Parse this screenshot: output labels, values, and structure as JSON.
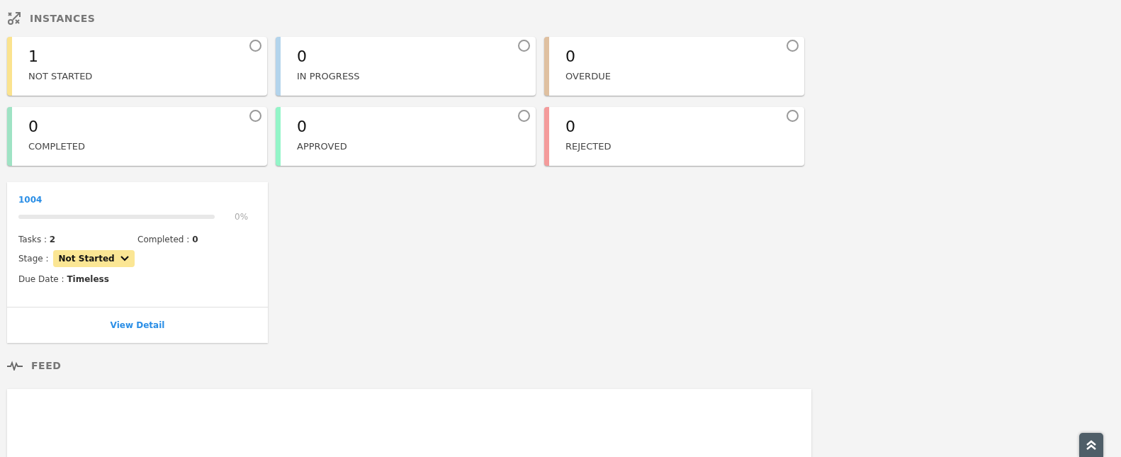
{
  "instances_header": {
    "title": "INSTANCES"
  },
  "stat_cards": [
    {
      "count": "1",
      "label": "NOT STARTED",
      "color": "#fbe38e",
      "selected": false
    },
    {
      "count": "0",
      "label": "IN PROGRESS",
      "color": "#b3d4ec",
      "selected": false
    },
    {
      "count": "0",
      "label": "OVERDUE",
      "color": "#dfc0a0",
      "selected": false
    },
    {
      "count": "0",
      "label": "COMPLETED",
      "color": "#9fe3c4",
      "selected": false
    },
    {
      "count": "0",
      "label": "APPROVED",
      "color": "#93f5c8",
      "selected": false
    },
    {
      "count": "0",
      "label": "REJECTED",
      "color": "#f49b9b",
      "selected": false
    }
  ],
  "instance_cards": [
    {
      "title": "1004",
      "level": 0,
      "percent": "0%",
      "tasks_label": "Tasks :",
      "tasks": "2",
      "completed_label": "Completed :",
      "completed": "0",
      "stage_label": "Stage :",
      "stage": "Not Started",
      "due_label": "Due Date :",
      "due": "Timeless",
      "action": "View Detail"
    }
  ],
  "feed_header": {
    "title": "FEED"
  }
}
